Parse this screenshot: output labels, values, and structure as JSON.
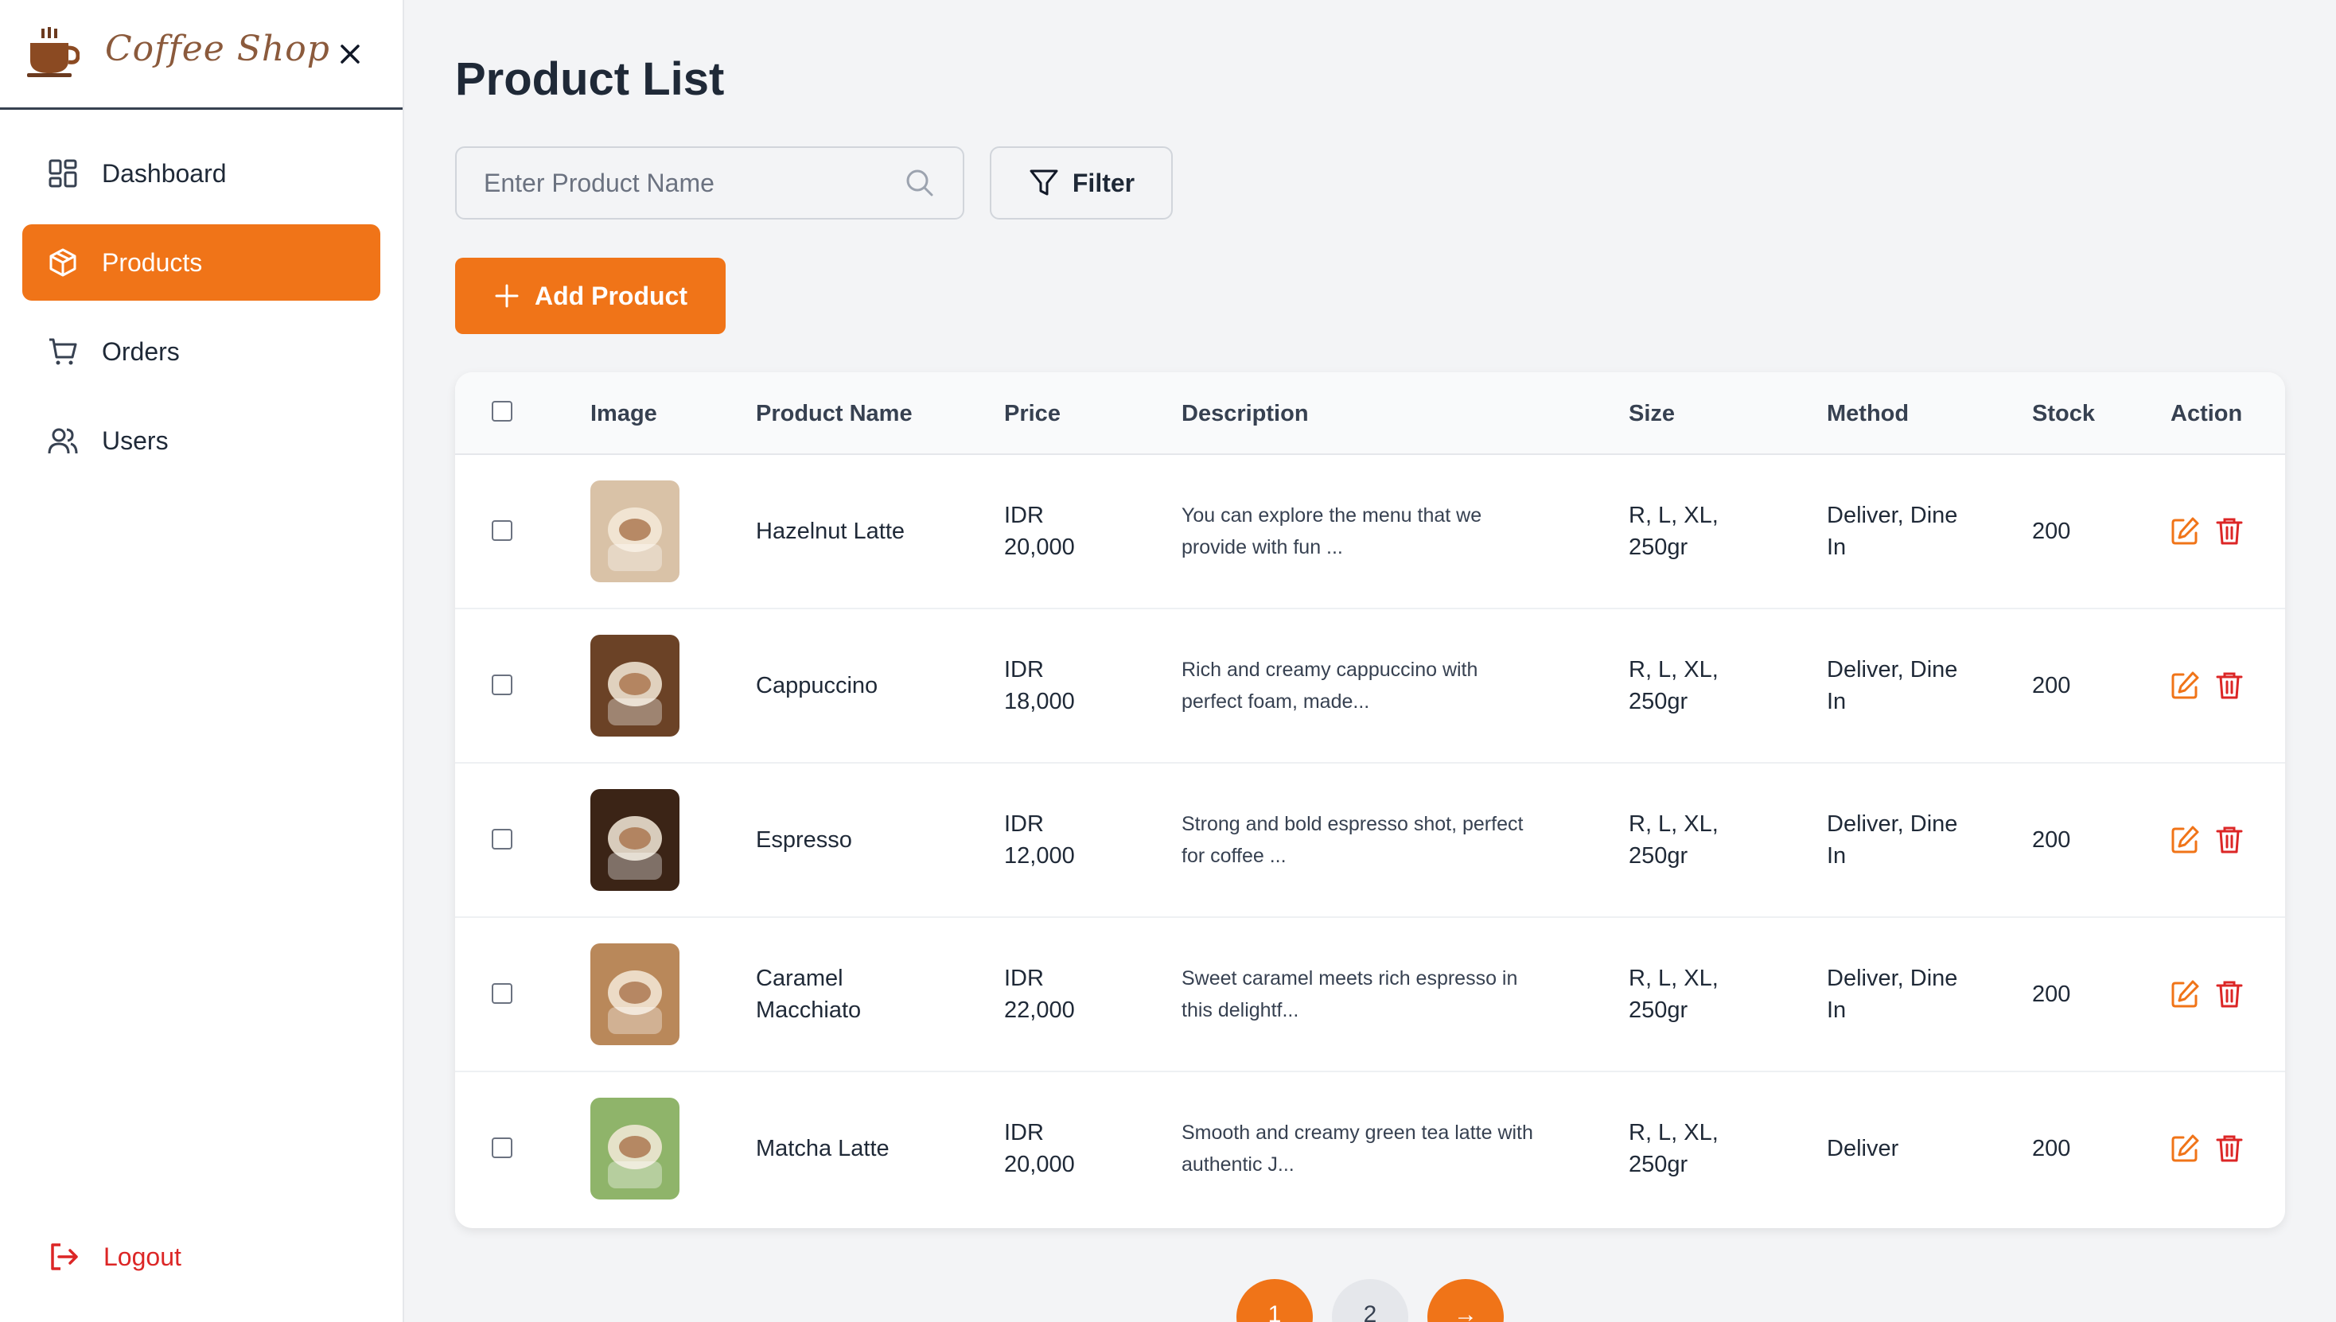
{
  "app": {
    "brand_name": "Coffee Shop",
    "accent_color": "#f07418"
  },
  "sidebar": {
    "items": [
      {
        "label": "Dashboard",
        "icon": "dashboard-grid-icon",
        "active": false
      },
      {
        "label": "Products",
        "icon": "box-icon",
        "active": true
      },
      {
        "label": "Orders",
        "icon": "cart-icon",
        "active": false
      },
      {
        "label": "Users",
        "icon": "users-icon",
        "active": false
      }
    ],
    "logout_label": "Logout"
  },
  "main": {
    "title": "Product List",
    "search_placeholder": "Enter Product Name",
    "filter_label": "Filter",
    "add_label": "Add Product"
  },
  "table": {
    "headers": {
      "image": "Image",
      "name": "Product Name",
      "price": "Price",
      "description": "Description",
      "size": "Size",
      "method": "Method",
      "stock": "Stock",
      "action": "Action"
    },
    "rows": [
      {
        "name1": "Hazelnut Latte",
        "name2": "",
        "price1": "IDR",
        "price2": "20,000",
        "desc1": "You can explore the menu that we",
        "desc2": "provide with fun ...",
        "size1": "R, L, XL,",
        "size2": "250gr",
        "method1": "Deliver, Dine",
        "method2": "In",
        "stock": "200",
        "thumb_color": "#d9c2a7"
      },
      {
        "name1": "Cappuccino",
        "name2": "",
        "price1": "IDR",
        "price2": "18,000",
        "desc1": "Rich and creamy cappuccino with",
        "desc2": "perfect foam, made...",
        "size1": "R, L, XL,",
        "size2": "250gr",
        "method1": "Deliver, Dine",
        "method2": "In",
        "stock": "200",
        "thumb_color": "#6b4226"
      },
      {
        "name1": "Espresso",
        "name2": "",
        "price1": "IDR",
        "price2": "12,000",
        "desc1": "Strong and bold espresso shot, perfect",
        "desc2": "for coffee ...",
        "size1": "R, L, XL,",
        "size2": "250gr",
        "method1": "Deliver, Dine",
        "method2": "In",
        "stock": "200",
        "thumb_color": "#3b2416"
      },
      {
        "name1": "Caramel",
        "name2": "Macchiato",
        "price1": "IDR",
        "price2": "22,000",
        "desc1": "Sweet caramel meets rich espresso in",
        "desc2": "this delightf...",
        "size1": "R, L, XL,",
        "size2": "250gr",
        "method1": "Deliver, Dine",
        "method2": "In",
        "stock": "200",
        "thumb_color": "#b9885a"
      },
      {
        "name1": "Matcha Latte",
        "name2": "",
        "price1": "IDR",
        "price2": "20,000",
        "desc1": "Smooth and creamy green tea latte with",
        "desc2": "authentic J...",
        "size1": "R, L, XL,",
        "size2": "250gr",
        "method1": "Deliver",
        "method2": "",
        "stock": "200",
        "thumb_color": "#8fb46a"
      }
    ]
  },
  "pagination": {
    "pages": [
      "1",
      "2"
    ],
    "current": "1",
    "next_symbol": "→"
  }
}
